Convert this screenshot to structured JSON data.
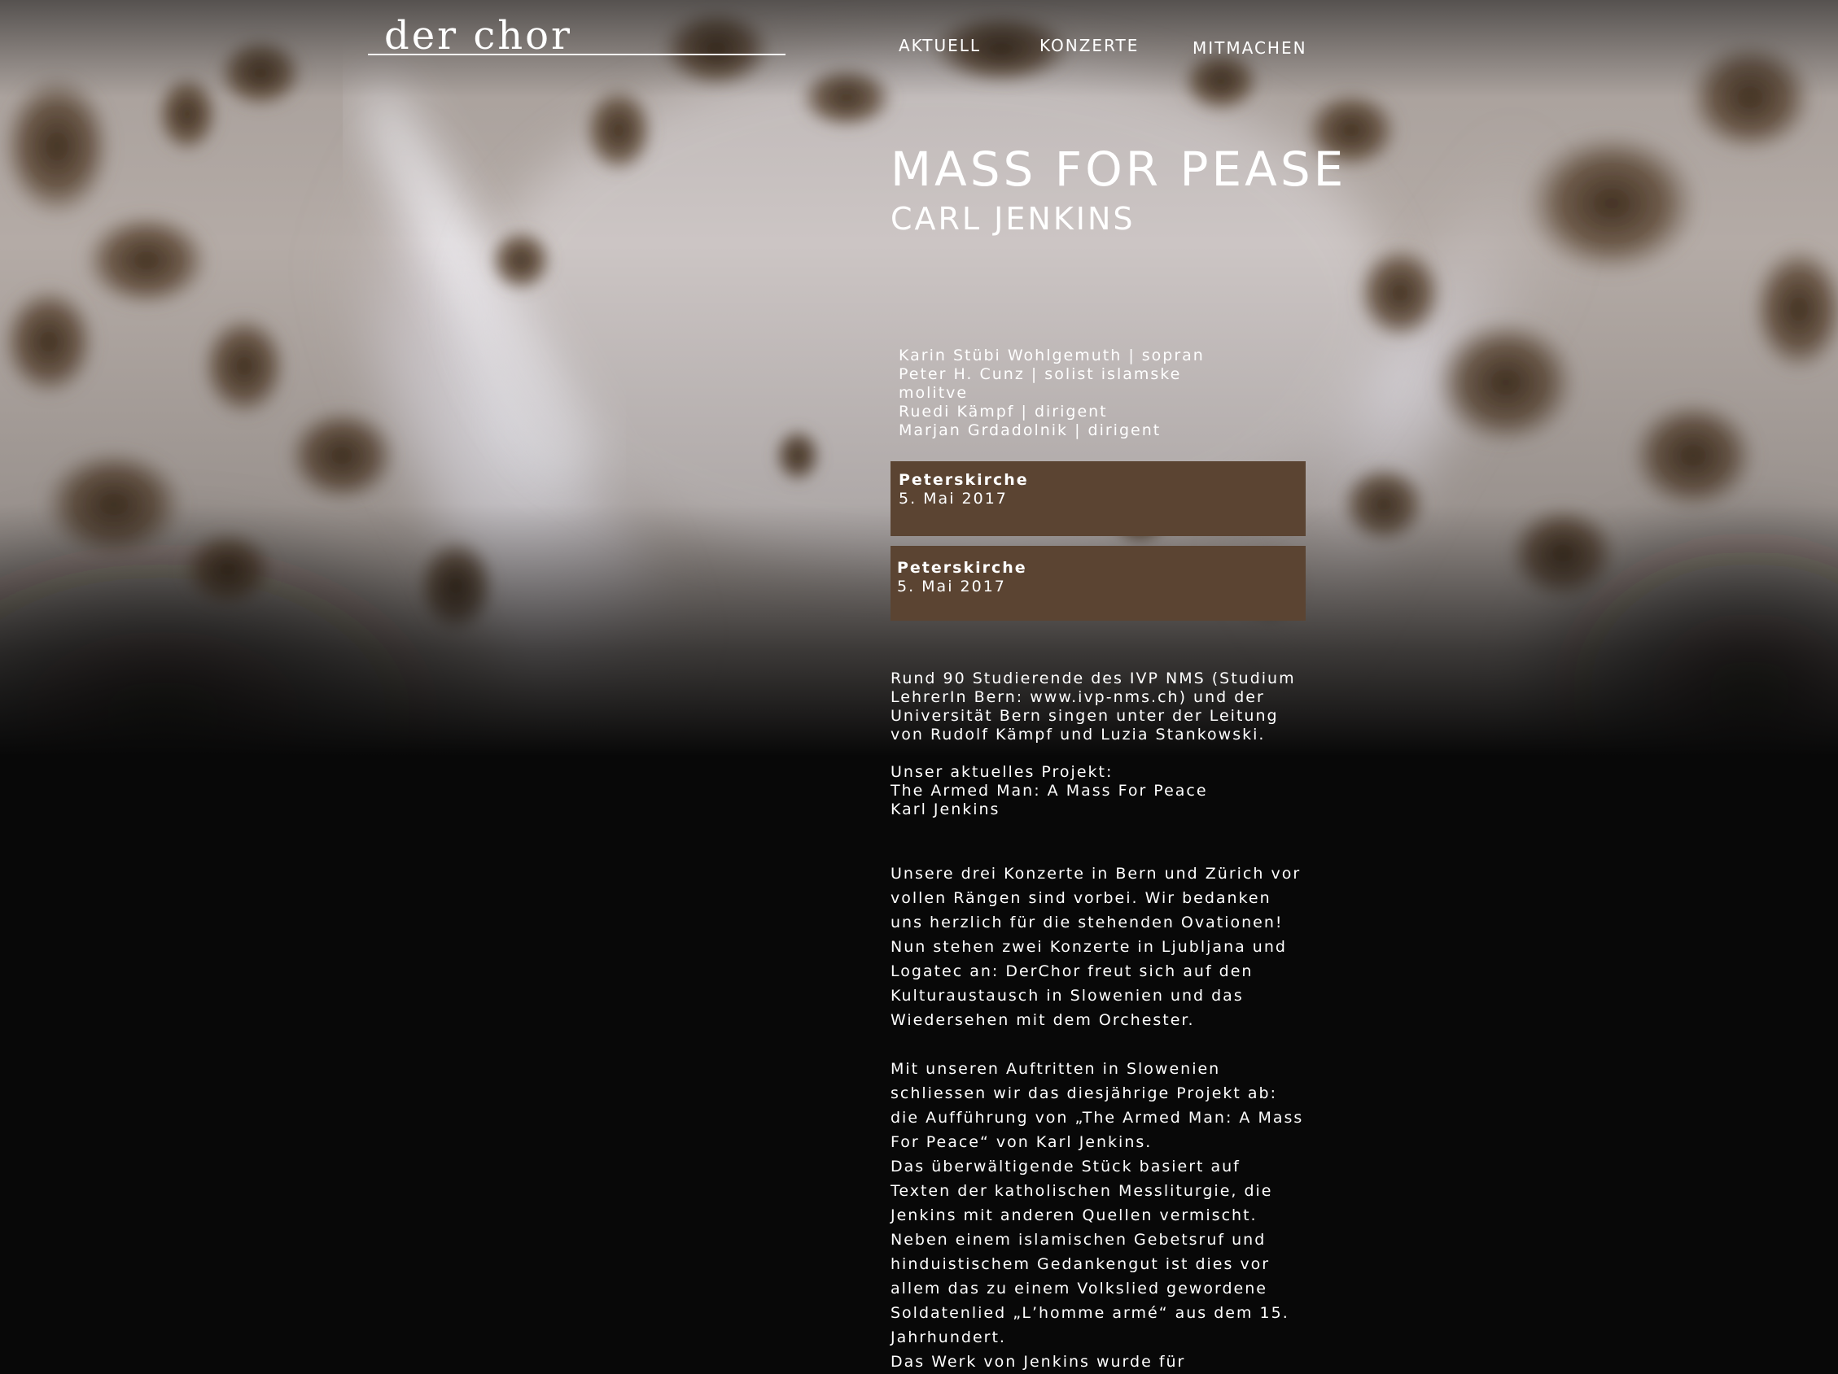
{
  "site": {
    "logo_text": "der chor"
  },
  "nav": {
    "items": [
      {
        "label": "AKTUELL"
      },
      {
        "label": "KONZERTE"
      },
      {
        "label": "MITMACHEN"
      }
    ]
  },
  "concert": {
    "title": "MASS FOR PEASE",
    "composer": "CARL JENKINS",
    "performers": [
      "Karin Stübi Wohlgemuth | sopran",
      "Peter H. Cunz | solist islamske",
      "molitve",
      "Ruedi Kämpf | dirigent",
      "Marjan Grdadolnik | dirigent"
    ],
    "dates": [
      {
        "venue": "Peterskirche",
        "date": "5. Mai 2017"
      },
      {
        "venue": "Peterskirche",
        "date": "5. Mai 2017"
      }
    ]
  },
  "content": {
    "intro": "Rund 90 Studierende des IVP NMS (Studium LehrerIn Bern: www.ivp-nms.ch) und der Universität Bern singen unter der Leitung von Rudolf Kämpf und Luzia Stankowski.",
    "project_lines": [
      "Unser aktuelles Projekt:",
      "The Armed Man: A Mass For Peace",
      "Karl Jenkins"
    ],
    "paragraph_1": "Unsere drei Konzerte in Bern und Zürich vor vollen Rängen sind vorbei. Wir bedanken uns herzlich für die stehenden Ovationen! Nun stehen zwei Konzerte in Ljubljana und Logatec an: DerChor freut sich auf den Kulturaustausch in Slowenien und das Wiedersehen mit dem Orchester.",
    "paragraph_2": "Mit unseren Auftritten in Slowenien schliessen wir das diesjährige Projekt ab: die Aufführung von „The Armed Man: A Mass For Peace“ von Karl Jenkins.",
    "paragraph_3": "Das überwältigende Stück basiert auf Texten der katholischen Messliturgie, die Jenkins mit anderen Quellen vermischt. Neben einem islamischen Gebetsruf und hinduistischem Gedankengut ist dies vor allem das zu einem Volkslied gewordene Soldatenlied „L’homme armé“ aus dem 15. Jahrhundert.",
    "paragraph_4": "Das Werk von Jenkins wurde für"
  },
  "colors": {
    "page_background": "#080808",
    "concert_box": "#5b4432",
    "text": "#ffffff",
    "artwork_light": "#d8d3d6",
    "artwork_stain": "#4a3420"
  }
}
